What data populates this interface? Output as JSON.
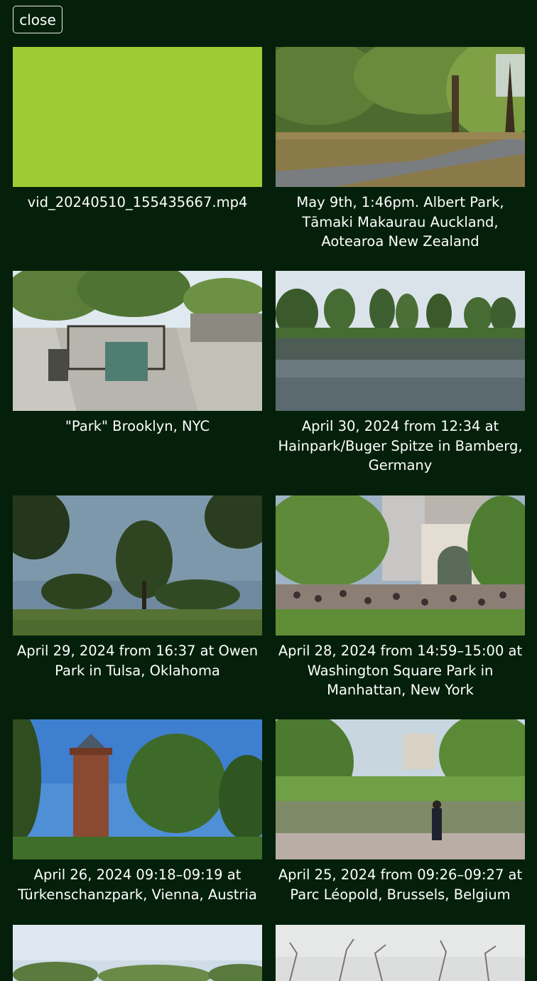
{
  "toolbar": {
    "close_label": "close"
  },
  "gallery": [
    {
      "caption": [
        "vid_20240510_155435667.mp4"
      ],
      "placeholder_color": "#9ecb33"
    },
    {
      "caption": [
        "May 9th, 1:46pm. Albert Park,",
        "Tāmaki Makaurau Auckland,",
        "Aotearoa New Zealand"
      ]
    },
    {
      "caption": [
        "\"Park\" Brooklyn, NYC"
      ]
    },
    {
      "caption": [
        "April 30, 2024 from 12:34 at",
        "Hainpark/Buger Spitze in Bamberg,",
        "Germany"
      ]
    },
    {
      "caption": [
        "April 29, 2024 from 16:37 at Owen",
        "Park in Tulsa, Oklahoma"
      ]
    },
    {
      "caption": [
        "April 28, 2024 from 14:59–15:00 at",
        "Washington Square Park in",
        "Manhattan, New York"
      ]
    },
    {
      "caption": [
        "April 26, 2024 09:18–09:19 at",
        "Türkenschanzpark, Vienna, Austria"
      ]
    },
    {
      "caption": [
        "April 25, 2024 from 09:26–09:27 at",
        "Parc Léopold, Brussels, Belgium"
      ]
    },
    {
      "caption": []
    },
    {
      "caption": []
    }
  ]
}
